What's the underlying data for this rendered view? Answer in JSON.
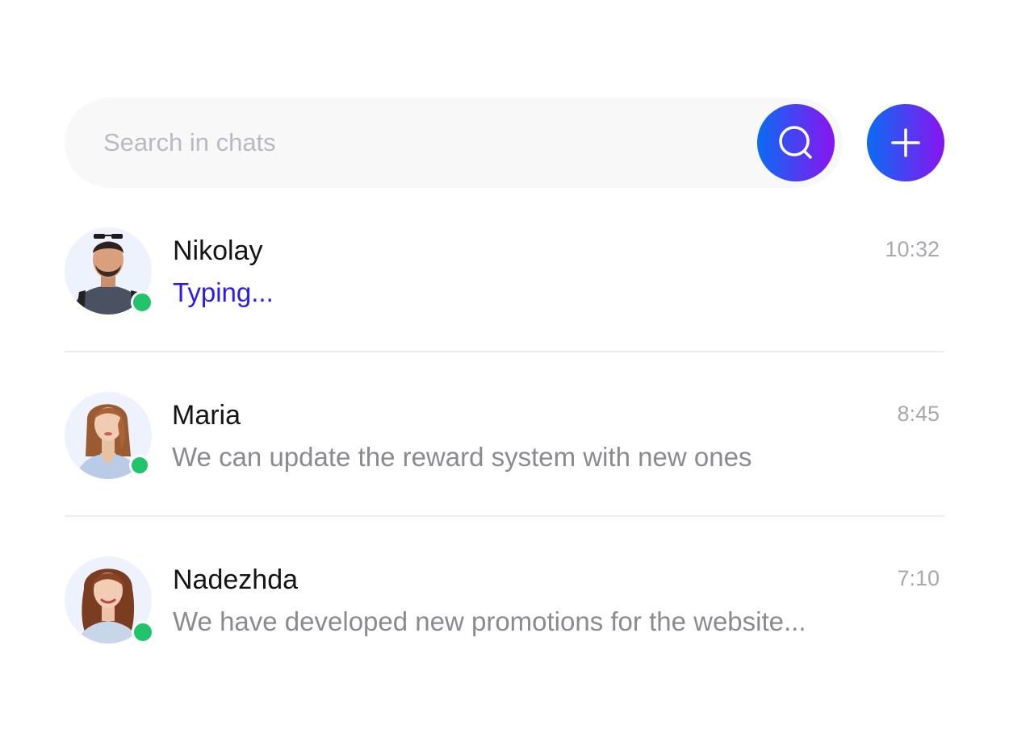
{
  "search": {
    "placeholder": "Search in chats",
    "button_icon": "search-icon",
    "add_icon": "plus-icon"
  },
  "colors": {
    "gradient_start": "#0a6cf2",
    "gradient_end": "#8a14f0",
    "online": "#22c46b",
    "typing": "#2a1cf0"
  },
  "chats": [
    {
      "name": "Nikolay",
      "time": "10:32",
      "message": "Typing...",
      "online": true,
      "typing": true
    },
    {
      "name": "Maria",
      "time": "8:45",
      "message": "We can update the reward system with new ones",
      "online": true,
      "typing": false
    },
    {
      "name": "Nadezhda",
      "time": "7:10",
      "message": "We have developed new promotions for the website...",
      "online": true,
      "typing": false
    }
  ]
}
